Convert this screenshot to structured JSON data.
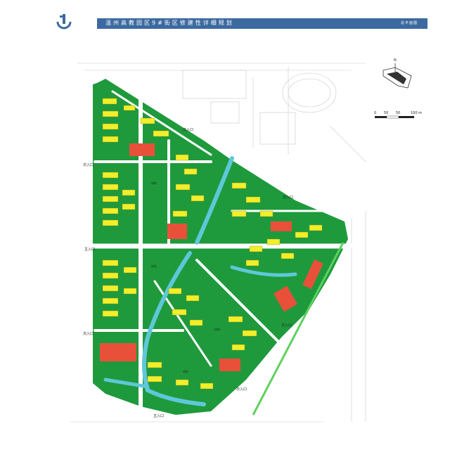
{
  "header": {
    "title": "温州高教园区9#街区修建性详细规划",
    "subtitle": "总平面图"
  },
  "map": {
    "north_label": "N",
    "scale_labels": [
      "0",
      "50",
      "50",
      "100 m"
    ],
    "entrances": {
      "secondary": "次入口",
      "main": "主入口"
    },
    "block_labels": {
      "green1": "绿地",
      "green2": "绿地",
      "green3": "绿地",
      "green4": "绿地"
    }
  },
  "colors": {
    "title_bar": "#3c6aa0",
    "green": "#1e9a3c",
    "yellow": "#f2ee2a",
    "red": "#e8503a",
    "water": "#5ec8d8",
    "road": "#ffffff"
  },
  "icons": [
    "logo-icon",
    "north-arrow-icon",
    "scale-bar-icon"
  ]
}
